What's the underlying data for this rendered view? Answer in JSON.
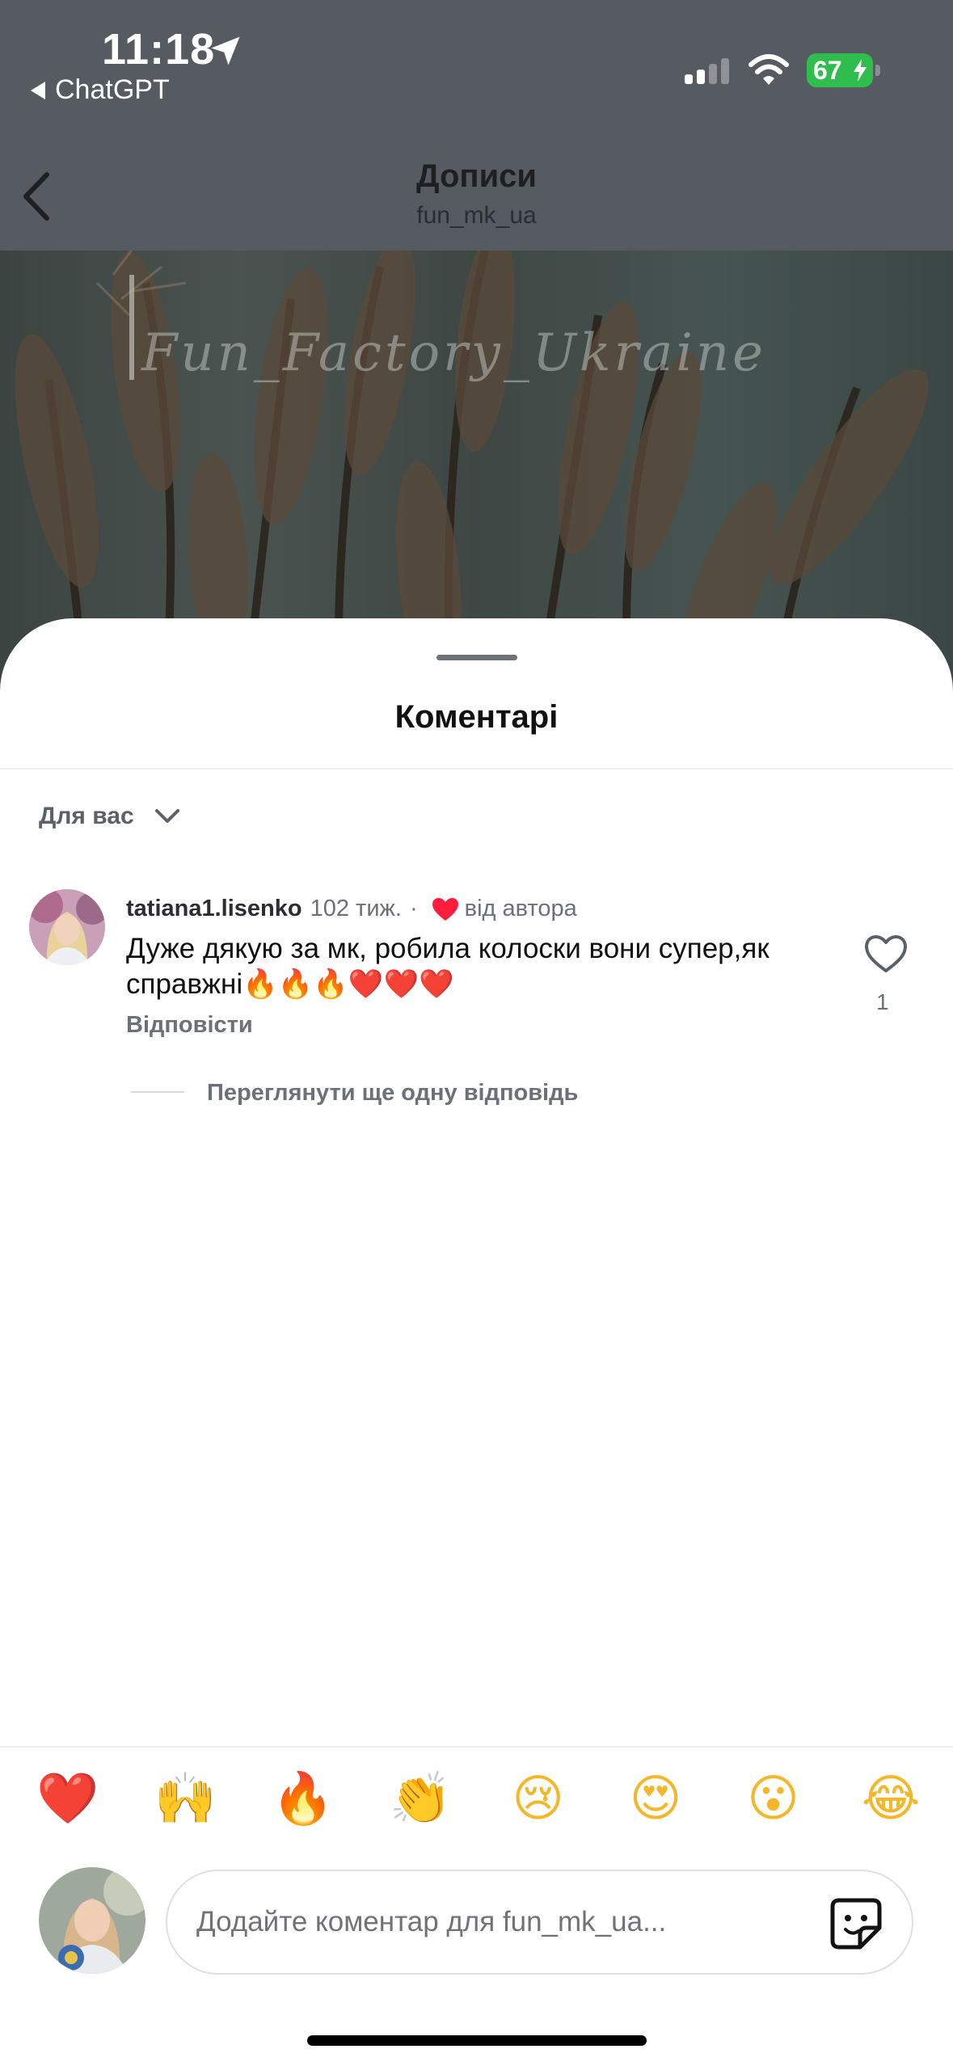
{
  "status_bar": {
    "time": "11:18",
    "back_app": "ChatGPT",
    "battery_percent": "67",
    "icons": [
      "location-arrow-icon",
      "cell-signal-icon",
      "wifi-icon",
      "battery-icon"
    ]
  },
  "header": {
    "title": "Дописи",
    "subtitle": "fun_mk_ua",
    "back_icon": "chevron-left-icon"
  },
  "post_image": {
    "watermark": "Fun_Factory_Ukraine"
  },
  "sheet": {
    "title": "Коментарі",
    "filter_label": "Для вас",
    "filter_icon": "chevron-down-icon"
  },
  "comments": [
    {
      "username": "tatiana1.lisenko",
      "time_ago": "102 тиж.",
      "separator": "·",
      "author_badge": "від автора",
      "text": "Дуже дякую за мк, робила колоски вони супер,як  справжні",
      "emoji_fire": "🔥🔥🔥",
      "emoji_hearts": "❤️❤️❤️",
      "reply_label": "Відповісти",
      "like_count": "1",
      "view_more_label": "Переглянути ще одну відповідь"
    }
  ],
  "quick_reactions": [
    "❤️",
    "🙌",
    "🔥",
    "👏",
    "😢",
    "😍",
    "😮",
    "😂"
  ],
  "composer": {
    "placeholder": "Додайте коментар для fun_mk_ua...",
    "sticker_icon": "sticker-icon"
  },
  "colors": {
    "header_bg": "#555b61",
    "battery_green": "#2fbe4d",
    "like_red": "#ff1f3d",
    "muted_text": "#6b7079"
  }
}
